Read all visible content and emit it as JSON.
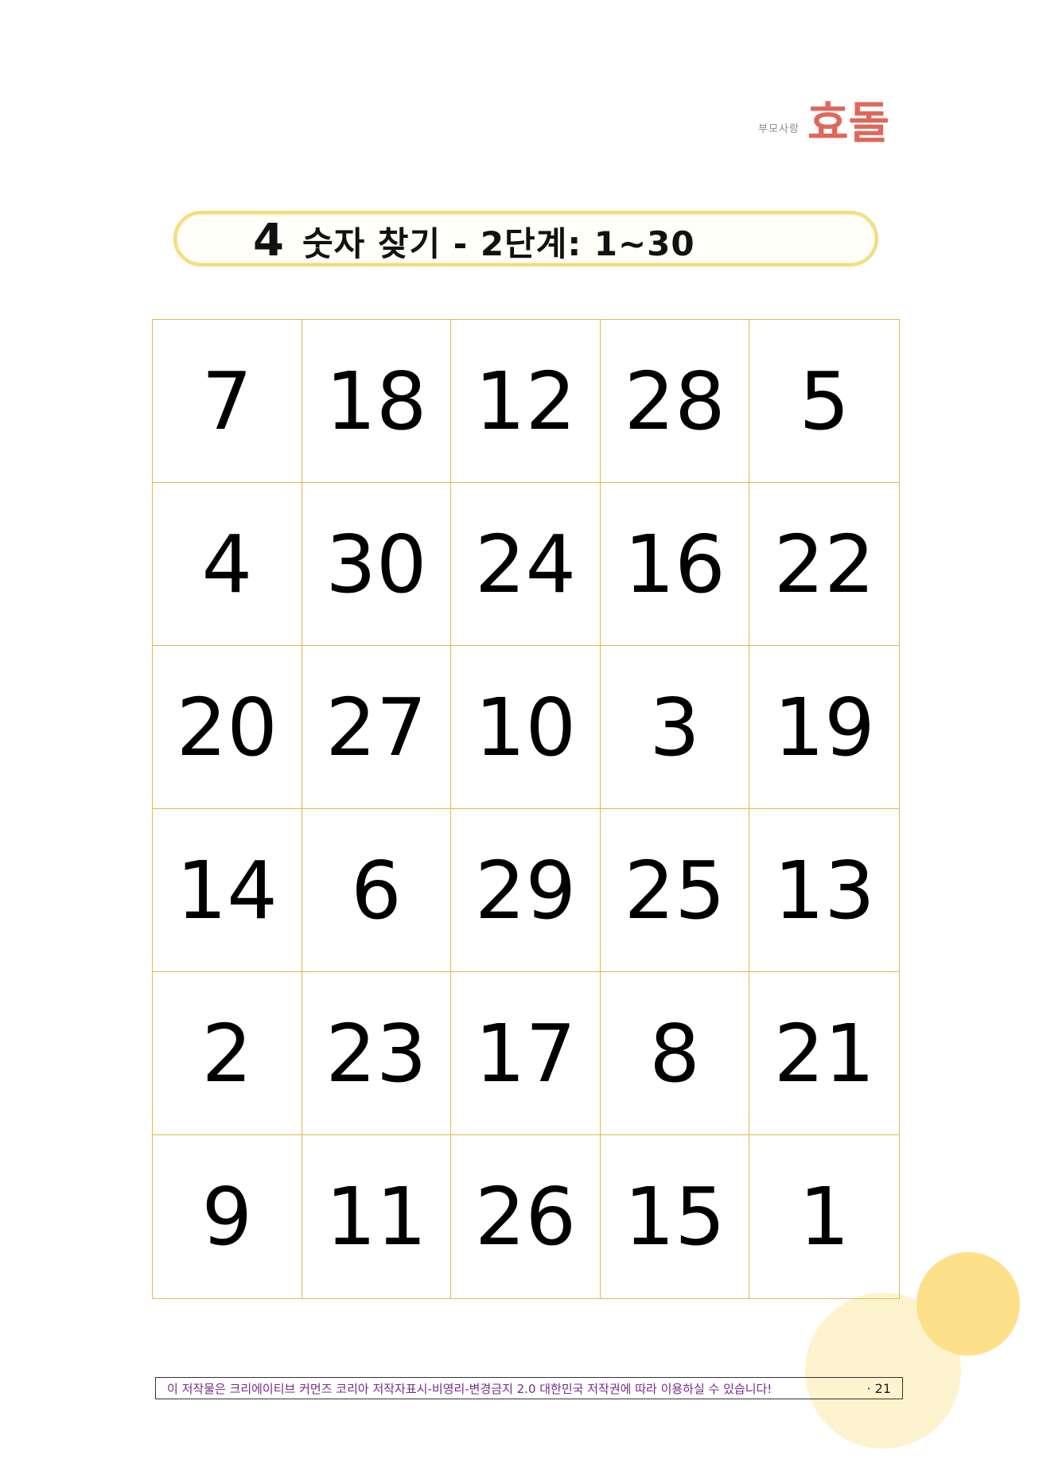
{
  "logo": {
    "small": "부모사랑",
    "big": "효돌"
  },
  "title": {
    "number": "4",
    "text": "숫자 찾기 - 2단계: 1~30"
  },
  "grid": [
    [
      "7",
      "18",
      "12",
      "28",
      "5"
    ],
    [
      "4",
      "30",
      "24",
      "16",
      "22"
    ],
    [
      "20",
      "27",
      "10",
      "3",
      "19"
    ],
    [
      "14",
      "6",
      "29",
      "25",
      "13"
    ],
    [
      "2",
      "23",
      "17",
      "8",
      "21"
    ],
    [
      "9",
      "11",
      "26",
      "15",
      "1"
    ]
  ],
  "footer": {
    "license": "이 저작물은 크리에이티브 커먼즈 코리아 저작자표시-비영리-변경금지 2.0 대한민국 저작권에 따라 이용하실 수 있습니다!",
    "page": "· 21"
  },
  "colors": {
    "grid_line": "#e3b84a",
    "pill_border": "#f4dc80",
    "logo_accent": "#e0675a",
    "footer_text": "#7a2a8c",
    "circle_light": "#fdf1c6",
    "circle_dark": "#fde08a"
  }
}
